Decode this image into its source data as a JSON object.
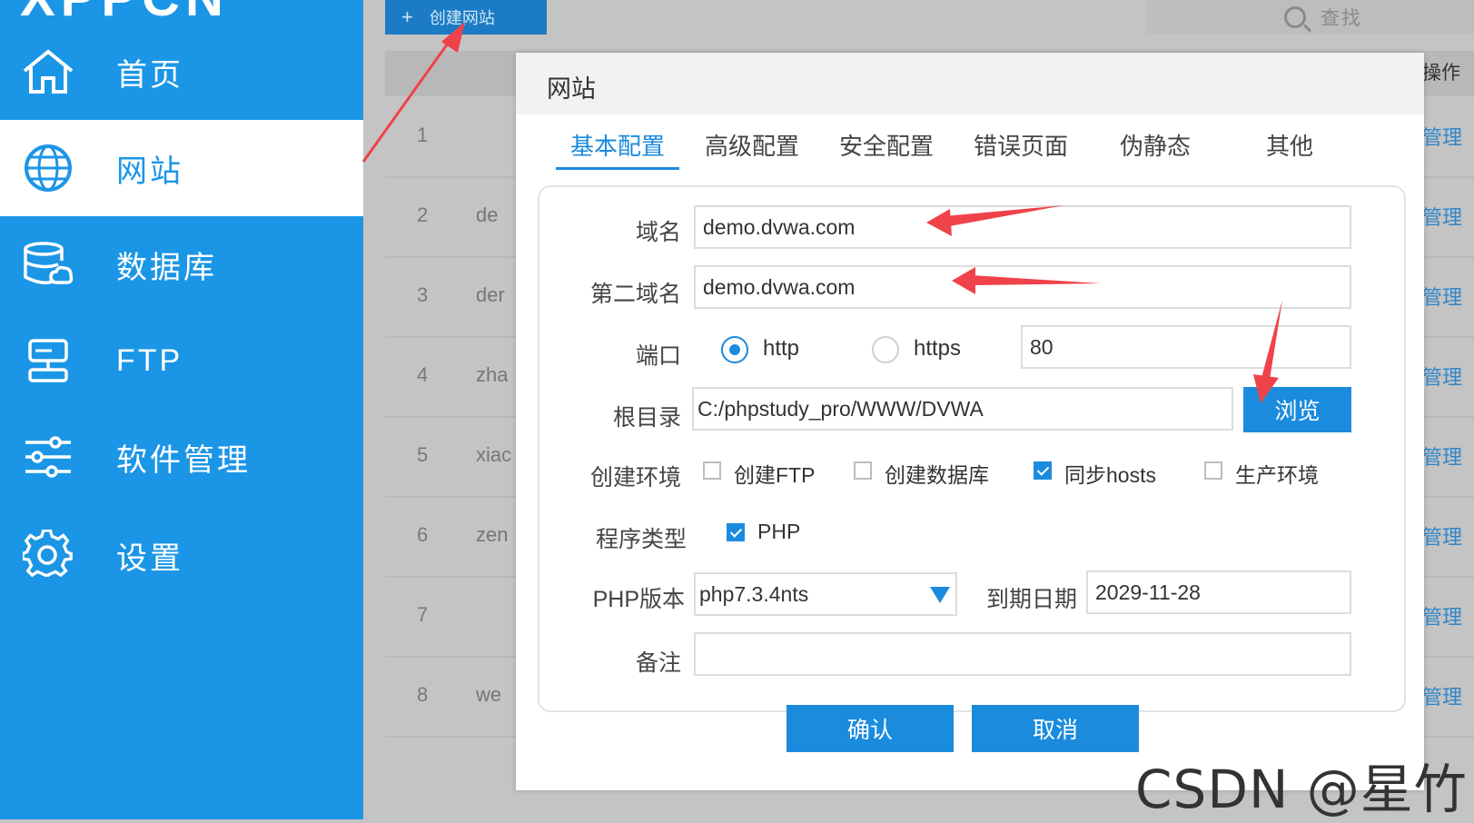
{
  "sidebar": {
    "logo": "XPPCN",
    "items": [
      {
        "label": "首页",
        "icon": "home-icon"
      },
      {
        "label": "网站",
        "icon": "globe-icon",
        "active": true
      },
      {
        "label": "数据库",
        "icon": "database-icon"
      },
      {
        "label": "FTP",
        "icon": "ftp-server-icon"
      },
      {
        "label": "软件管理",
        "icon": "sliders-icon"
      },
      {
        "label": "设置",
        "icon": "gear-icon"
      }
    ]
  },
  "toolbar": {
    "create_site_label": "创建网站",
    "search_placeholder": "查找"
  },
  "table": {
    "op_header": "操作",
    "rows": [
      {
        "num": "1",
        "name": "",
        "action": "管理"
      },
      {
        "num": "2",
        "name": "de",
        "action": "管理"
      },
      {
        "num": "3",
        "name": "der",
        "action": "管理"
      },
      {
        "num": "4",
        "name": "zha",
        "action": "管理"
      },
      {
        "num": "5",
        "name": "xiac",
        "action": "管理"
      },
      {
        "num": "6",
        "name": "zen",
        "action": "管理"
      },
      {
        "num": "7",
        "name": "",
        "action": "管理"
      },
      {
        "num": "8",
        "name": "we",
        "action": "管理"
      }
    ]
  },
  "dialog": {
    "title": "网站",
    "tabs": [
      "基本配置",
      "高级配置",
      "安全配置",
      "错误页面",
      "伪静态",
      "其他"
    ],
    "form": {
      "domain_label": "域名",
      "domain_value": "demo.dvwa.com",
      "second_domain_label": "第二域名",
      "second_domain_value": "demo.dvwa.com",
      "port_label": "端口",
      "http_label": "http",
      "https_label": "https",
      "port_value": "80",
      "root_label": "根目录",
      "root_value": "C:/phpstudy_pro/WWW/DVWA",
      "browse_label": "浏览",
      "env_label": "创建环境",
      "env_options": [
        {
          "label": "创建FTP",
          "checked": false
        },
        {
          "label": "创建数据库",
          "checked": false
        },
        {
          "label": "同步hosts",
          "checked": true
        },
        {
          "label": "生产环境",
          "checked": false
        }
      ],
      "program_type_label": "程序类型",
      "program_type_option": "PHP",
      "php_version_label": "PHP版本",
      "php_version_value": "php7.3.4nts",
      "expire_label": "到期日期",
      "expire_value": "2029-11-28",
      "note_label": "备注",
      "note_value": ""
    },
    "confirm_label": "确认",
    "cancel_label": "取消"
  },
  "watermark": "CSDN @星竹",
  "colors": {
    "accent": "#1b96e6",
    "annotation_arrow": "#f0424a"
  }
}
